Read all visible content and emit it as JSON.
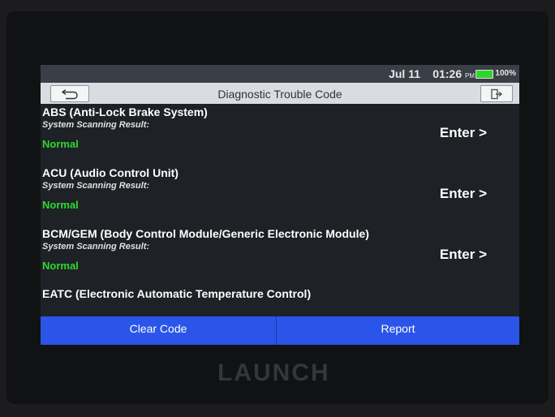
{
  "status_bar": {
    "date": "Jul 11",
    "time": "01:26",
    "ampm": "PM",
    "battery": "100%"
  },
  "title_bar": {
    "title": "Diagnostic Trouble Code"
  },
  "systems": [
    {
      "name": "ABS (Anti-Lock Brake System)",
      "label": "System Scanning Result:",
      "status": "Normal",
      "action": "Enter >"
    },
    {
      "name": "ACU (Audio Control Unit)",
      "label": "System Scanning Result:",
      "status": "Normal",
      "action": "Enter >"
    },
    {
      "name": "BCM/GEM (Body Control Module/Generic Electronic Module)",
      "label": "System Scanning Result:",
      "status": "Normal",
      "action": "Enter >"
    },
    {
      "name": "EATC (Electronic Automatic Temperature Control)"
    }
  ],
  "buttons": {
    "clear_code": "Clear Code",
    "report": "Report"
  },
  "brand": "LAUNCH",
  "colors": {
    "accent": "#2a55e8",
    "status_normal": "#2ed92e",
    "battery": "#2fd52f"
  },
  "icons": {
    "back": "back-arrow-icon",
    "exit": "exit-icon"
  }
}
